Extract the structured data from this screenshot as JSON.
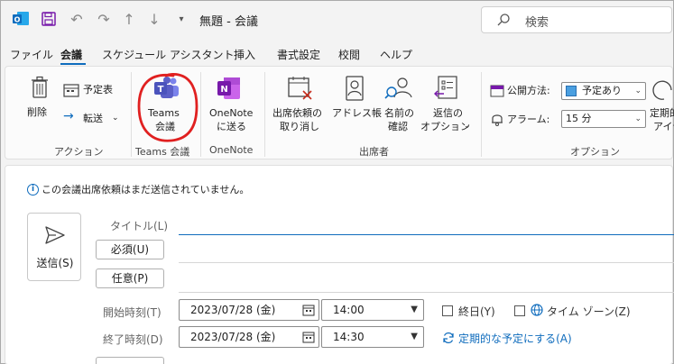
{
  "window": {
    "title": "無題 - 会議"
  },
  "search": {
    "placeholder": "検索"
  },
  "menu": {
    "items": [
      "ファイル",
      "会議",
      "スケジュール アシスタント",
      "挿入",
      "書式設定",
      "校閲",
      "ヘルプ"
    ],
    "active": "会議"
  },
  "ribbon": {
    "delete_label": "削除",
    "calendar_label": "予定表",
    "forward_label": "転送",
    "group_action": "アクション",
    "teams_label_1": "Teams",
    "teams_label_2": "会議",
    "group_teams": "Teams 会議",
    "onenote_label_1": "OneNote",
    "onenote_label_2": "に送る",
    "group_onenote": "OneNote",
    "cancel_invite_1": "出席依頼の",
    "cancel_invite_2": "取り消し",
    "address_book": "アドレス帳",
    "check_names_1": "名前の",
    "check_names_2": "確認",
    "response_1": "返信の",
    "response_2": "オプション",
    "group_attendees": "出席者",
    "show_as_label": "公開方法:",
    "show_as_value": "予定あり",
    "reminder_label": "アラーム:",
    "reminder_value": "15 分",
    "recurrence_1": "定期的",
    "recurrence_2": "アイテ",
    "group_options": "オプション"
  },
  "form": {
    "info": "この会議出席依頼はまだ送信されていません。",
    "send_label": "送信(S)",
    "title_label": "タイトル(L)",
    "required_label": "必須(U)",
    "optional_label": "任意(P)",
    "start_label": "開始時刻(T)",
    "end_label": "終了時刻(D)",
    "start_date": "2023/07/28 (金)",
    "start_time": "14:00",
    "end_date": "2023/07/28 (金)",
    "end_time": "14:30",
    "allday_label": "終日(Y)",
    "timezone_label": "タイム ゾーン(Z)",
    "recurring_link": "定期的な予定にする(A)"
  },
  "colors": {
    "accent": "#0f6cbd",
    "teams": "#5b5fc7",
    "onenote": "#7719aa",
    "annotation": "#e02020"
  }
}
